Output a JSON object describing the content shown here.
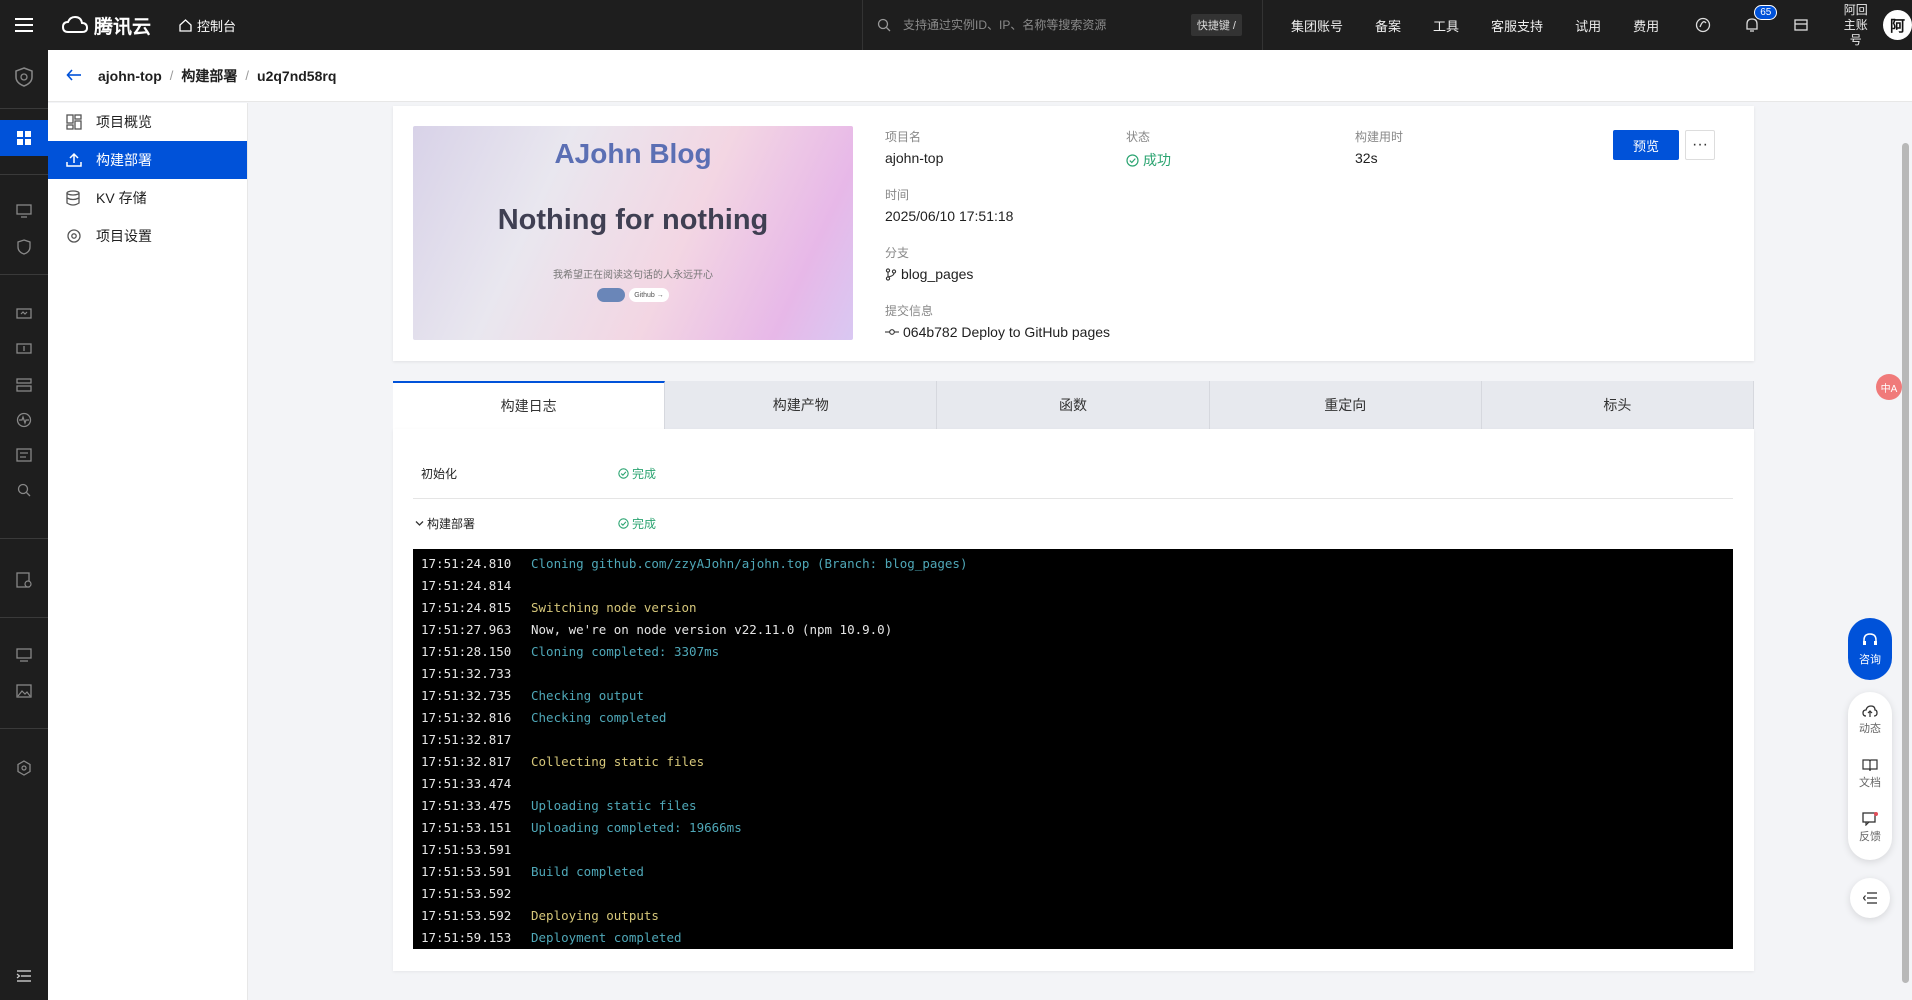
{
  "topbar": {
    "brand": "腾讯云",
    "console": "控制台",
    "search_placeholder": "支持通过实例ID、IP、名称等搜索资源",
    "shortcut": "快捷键 /",
    "links": [
      "集团账号",
      "备案",
      "工具",
      "客服支持",
      "试用",
      "费用"
    ],
    "notification_count": "65",
    "account_line1": "阿回",
    "account_line2": "主账号",
    "avatar_text": "阿"
  },
  "breadcrumb": {
    "items": [
      "ajohn-top",
      "构建部署",
      "u2q7nd58rq"
    ],
    "separator": "/"
  },
  "sidenav": {
    "items": [
      {
        "label": "项目概览",
        "icon": "overview-icon"
      },
      {
        "label": "构建部署",
        "icon": "upload-icon"
      },
      {
        "label": "KV 存储",
        "icon": "database-icon"
      },
      {
        "label": "项目设置",
        "icon": "settings-icon"
      }
    ],
    "active": "构建部署"
  },
  "preview": {
    "blog_title": "AJohn Blog",
    "slogan": "Nothing for nothing",
    "subtitle": "我希望正在阅读这句话的人永远开心",
    "btn2": "Github →"
  },
  "deploy": {
    "project_label": "项目名",
    "project_value": "ajohn-top",
    "status_label": "状态",
    "status_value": "成功",
    "duration_label": "构建用时",
    "duration_value": "32s",
    "time_label": "时间",
    "time_value": "2025/06/10 17:51:18",
    "branch_label": "分支",
    "branch_value": "blog_pages",
    "commit_label": "提交信息",
    "commit_value": "064b782 Deploy to GitHub pages",
    "preview_button": "预览",
    "more_button": "···"
  },
  "tabs": [
    "构建日志",
    "构建产物",
    "函数",
    "重定向",
    "标头"
  ],
  "steps": [
    {
      "name": "初始化",
      "status": "完成"
    },
    {
      "name": "构建部署",
      "status": "完成"
    }
  ],
  "log": [
    {
      "time": "17:51:24.810",
      "msg": "Cloning github.com/zzyAJohn/ajohn.top (Branch: blog_pages)",
      "color": "cyan"
    },
    {
      "time": "17:51:24.814",
      "msg": "",
      "color": "white"
    },
    {
      "time": "17:51:24.815",
      "msg": "Switching node version",
      "color": "yellow"
    },
    {
      "time": "17:51:27.963",
      "msg": "Now, we're on node version v22.11.0 (npm 10.9.0)",
      "color": "white"
    },
    {
      "time": "17:51:28.150",
      "msg": "Cloning completed: 3307ms",
      "color": "cyan"
    },
    {
      "time": "17:51:32.733",
      "msg": "",
      "color": "white"
    },
    {
      "time": "17:51:32.735",
      "msg": "Checking output",
      "color": "cyan"
    },
    {
      "time": "17:51:32.816",
      "msg": "Checking completed",
      "color": "cyan"
    },
    {
      "time": "17:51:32.817",
      "msg": "",
      "color": "white"
    },
    {
      "time": "17:51:32.817",
      "msg": "Collecting static files",
      "color": "yellow"
    },
    {
      "time": "17:51:33.474",
      "msg": "",
      "color": "white"
    },
    {
      "time": "17:51:33.475",
      "msg": "Uploading static files",
      "color": "cyan"
    },
    {
      "time": "17:51:53.151",
      "msg": "Uploading completed: 19666ms",
      "color": "cyan"
    },
    {
      "time": "17:51:53.591",
      "msg": "",
      "color": "white"
    },
    {
      "time": "17:51:53.591",
      "msg": "Build completed",
      "color": "cyan"
    },
    {
      "time": "17:51:53.592",
      "msg": "",
      "color": "white"
    },
    {
      "time": "17:51:53.592",
      "msg": "Deploying outputs",
      "color": "yellow"
    },
    {
      "time": "17:51:59.153",
      "msg": "Deployment completed",
      "color": "cyan"
    }
  ],
  "float_tools": {
    "consult": "咨询",
    "dynamic": "动态",
    "docs": "文档",
    "feedback": "反馈",
    "translate": "中A"
  },
  "colors": {
    "primary": "#0052d9",
    "success": "#2ba471",
    "topbar": "#1e1e1e"
  }
}
